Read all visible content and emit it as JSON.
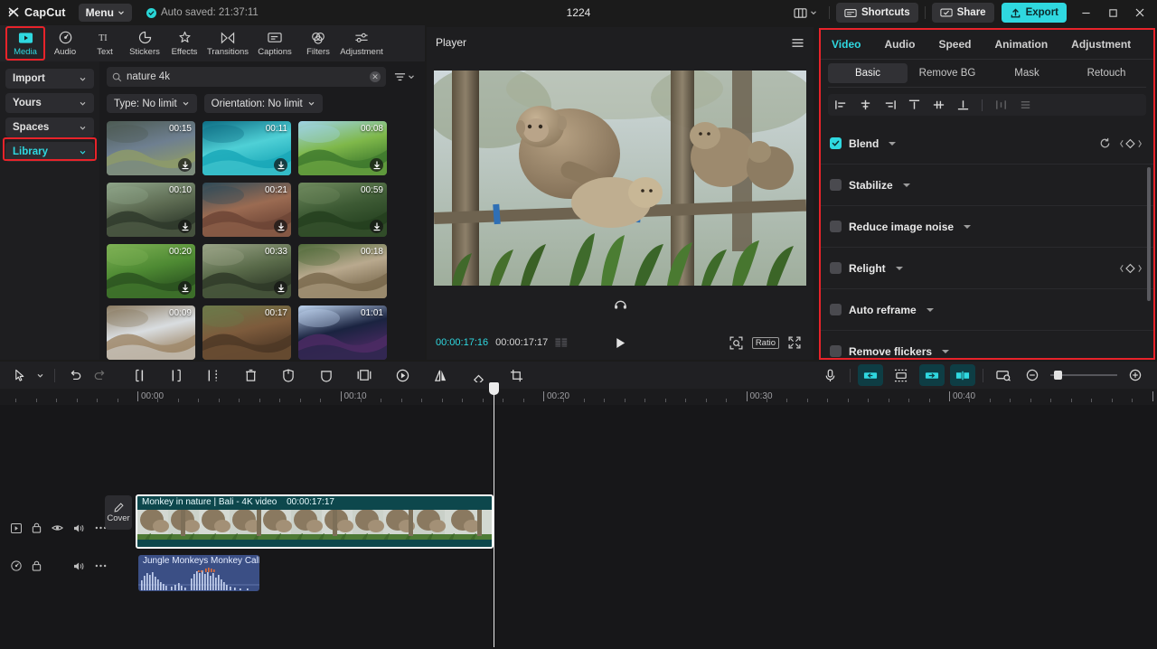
{
  "app": {
    "brand": "CapCut",
    "menu_label": "Menu",
    "autosave_text": "Auto saved: 21:37:11",
    "project_title": "1224"
  },
  "titlebar": {
    "layout_icon": "layout-icon",
    "shortcuts_label": "Shortcuts",
    "share_label": "Share",
    "export_label": "Export",
    "minimize": "minimize-icon",
    "maximize": "maximize-icon",
    "close": "close-icon"
  },
  "tool_tabs": [
    {
      "label": "Media",
      "icon": "media-icon",
      "active": true
    },
    {
      "label": "Audio",
      "icon": "audio-icon",
      "active": false
    },
    {
      "label": "Text",
      "icon": "text-icon",
      "active": false
    },
    {
      "label": "Stickers",
      "icon": "stickers-icon",
      "active": false
    },
    {
      "label": "Effects",
      "icon": "effects-icon",
      "active": false
    },
    {
      "label": "Transitions",
      "icon": "transitions-icon",
      "active": false
    },
    {
      "label": "Captions",
      "icon": "captions-icon",
      "active": false
    },
    {
      "label": "Filters",
      "icon": "filters-icon",
      "active": false
    },
    {
      "label": "Adjustment",
      "icon": "adjustment-icon",
      "active": false
    }
  ],
  "sidebar": {
    "items": [
      {
        "label": "Import",
        "active": false
      },
      {
        "label": "Yours",
        "active": false
      },
      {
        "label": "Spaces",
        "active": false
      },
      {
        "label": "Library",
        "active": true
      }
    ]
  },
  "media": {
    "search": {
      "value": "nature 4k",
      "placeholder": "Search"
    },
    "filters": [
      {
        "label": "Type: No limit"
      },
      {
        "label": "Orientation: No limit"
      }
    ],
    "items": [
      {
        "duration": "00:15",
        "downloadable": true,
        "c1": "#6e7f90",
        "c2": "#8d9a6a",
        "c3": "#4c5a52"
      },
      {
        "duration": "00:11",
        "downloadable": true,
        "c1": "#4fd0d6",
        "c2": "#1aa8b8",
        "c3": "#0d6e85"
      },
      {
        "duration": "00:08",
        "downloadable": true,
        "c1": "#7fb84a",
        "c2": "#3f7a2e",
        "c3": "#9fd3e8"
      },
      {
        "duration": "00:10",
        "downloadable": true,
        "c1": "#5d6b52",
        "c2": "#2f3a2c",
        "c3": "#8fa58a"
      },
      {
        "duration": "00:21",
        "downloadable": true,
        "c1": "#9b6b52",
        "c2": "#6d4536",
        "c3": "#2e4a58"
      },
      {
        "duration": "00:59",
        "downloadable": true,
        "c1": "#3d5a34",
        "c2": "#24401f",
        "c3": "#6f8a5e"
      },
      {
        "duration": "00:20",
        "downloadable": true,
        "c1": "#4e8a33",
        "c2": "#2b5320",
        "c3": "#7fb255"
      },
      {
        "duration": "00:33",
        "downloadable": true,
        "c1": "#5a6b4a",
        "c2": "#2f3a28",
        "c3": "#9aa487"
      },
      {
        "duration": "00:18",
        "downloadable": false,
        "c1": "#b9a98e",
        "c2": "#7a6a4e",
        "c3": "#4f6a3a"
      },
      {
        "duration": "00:09",
        "downloadable": false,
        "c1": "#d9dde0",
        "c2": "#a08a6c",
        "c3": "#8a7a60"
      },
      {
        "duration": "00:17",
        "downloadable": false,
        "c1": "#7d5b3c",
        "c2": "#4e3826",
        "c3": "#6b7a4a"
      },
      {
        "duration": "01:01",
        "downloadable": false,
        "c1": "#1a2340",
        "c2": "#4b2a63",
        "c3": "#bfd5f0"
      }
    ]
  },
  "player": {
    "title": "Player",
    "current_time": "00:00:17:16",
    "total_time": "00:00:17:17",
    "ratio_label": "Ratio",
    "play_icon": "play-icon",
    "fullscreen_icon": "fullscreen-icon",
    "zoom_fit_icon": "zoom-fit-icon",
    "headphone_icon": "headphone-icon",
    "menu_icon": "hamburger-icon"
  },
  "properties": {
    "tabs": [
      {
        "label": "Video",
        "active": true
      },
      {
        "label": "Audio",
        "active": false
      },
      {
        "label": "Speed",
        "active": false
      },
      {
        "label": "Animation",
        "active": false
      },
      {
        "label": "Adjustment",
        "active": false
      }
    ],
    "subtabs": [
      {
        "label": "Basic",
        "active": true
      },
      {
        "label": "Remove BG",
        "active": false
      },
      {
        "label": "Mask",
        "active": false
      },
      {
        "label": "Retouch",
        "active": false
      }
    ],
    "align_icons": [
      "align-left-icon",
      "align-center-horizontal-icon",
      "align-right-icon",
      "align-top-icon",
      "align-center-vertical-icon",
      "align-bottom-icon",
      "distribute-horizontal-icon",
      "distribute-vertical-icon"
    ],
    "options": [
      {
        "label": "Blend",
        "checked": true,
        "has_reset": true,
        "has_keyframe": true
      },
      {
        "label": "Stabilize",
        "checked": false,
        "has_reset": false,
        "has_keyframe": false
      },
      {
        "label": "Reduce image noise",
        "checked": false,
        "has_reset": false,
        "has_keyframe": false
      },
      {
        "label": "Relight",
        "checked": false,
        "has_reset": false,
        "has_keyframe": true
      },
      {
        "label": "Auto reframe",
        "checked": false,
        "has_reset": false,
        "has_keyframe": false
      },
      {
        "label": "Remove flickers",
        "checked": false,
        "has_reset": false,
        "has_keyframe": false
      }
    ]
  },
  "timeline_toolbar": {
    "left_tools": [
      "select-icon",
      "select-dropdown-icon",
      "undo-icon",
      "redo-icon",
      "split-icon",
      "trim-left-icon",
      "trim-right-icon",
      "delete-icon",
      "freeze-icon",
      "mask-icon",
      "picture-in-picture-icon",
      "speed-icon",
      "mirror-icon",
      "rotate-icon",
      "crop-icon"
    ],
    "right_tools": [
      {
        "name": "record-icon",
        "active": false
      },
      {
        "name": "snap-left-icon",
        "active": true
      },
      {
        "name": "auto-fit-icon",
        "active": false
      },
      {
        "name": "link-icon",
        "active": true
      },
      {
        "name": "snap-icon",
        "active": true
      },
      {
        "name": "keyframe-view-icon",
        "active": false
      }
    ],
    "zoom_out_icon": "zoom-out-icon",
    "zoom_in_icon": "zoom-in-icon"
  },
  "timeline": {
    "ruler_labels": [
      "00:00",
      "00:10",
      "00:20",
      "00:30",
      "00:40"
    ],
    "cover_label": "Cover",
    "video_track": {
      "clip_title": "Monkey in nature | Bali - 4K video",
      "clip_duration": "00:00:17:17",
      "head_icons": [
        "track-video-icon",
        "lock-icon",
        "eye-icon",
        "speaker-icon",
        "more-icon"
      ]
    },
    "audio_track": {
      "clip_title": "Jungle Monkeys Monkey Calls",
      "head_icons": [
        "track-audio-icon",
        "lock-icon",
        "speaker-icon",
        "more-icon"
      ]
    }
  },
  "colors": {
    "accent": "#2fd8e0",
    "highlight_box": "#e8232a",
    "video_clip": "#0f4a4f",
    "audio_clip": "#3b4f85"
  }
}
